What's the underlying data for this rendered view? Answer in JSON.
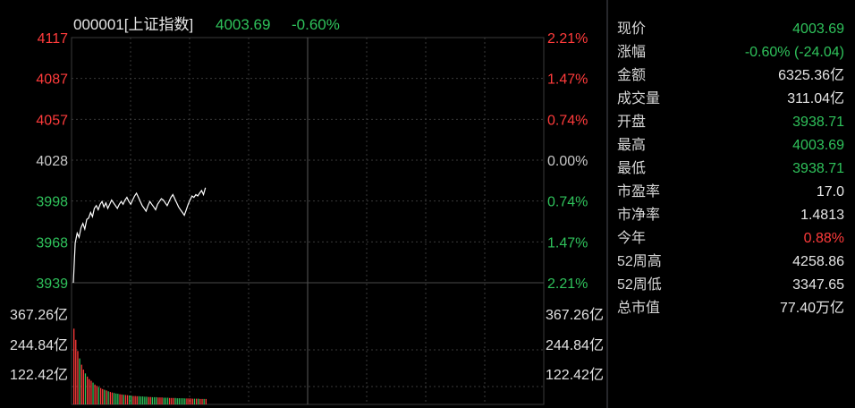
{
  "header": {
    "code_name": "000001[上证指数]",
    "price": "4003.69",
    "change_pct": "-0.60%"
  },
  "colors": {
    "up": "#ff3b3b",
    "down": "#2fc25b",
    "neutral": "#c8c8c8",
    "grid": "#3a3a3a",
    "price_line": "#ffffff"
  },
  "price_axis": {
    "left_ticks": [
      {
        "label": "4117",
        "tone": "up"
      },
      {
        "label": "4087",
        "tone": "up"
      },
      {
        "label": "4057",
        "tone": "up"
      },
      {
        "label": "4028",
        "tone": "neutral"
      },
      {
        "label": "3998",
        "tone": "down"
      },
      {
        "label": "3968",
        "tone": "down"
      },
      {
        "label": "3939",
        "tone": "down"
      }
    ],
    "right_ticks": [
      {
        "label": "2.21%",
        "tone": "up"
      },
      {
        "label": "1.47%",
        "tone": "up"
      },
      {
        "label": "0.74%",
        "tone": "up"
      },
      {
        "label": "0.00%",
        "tone": "neutral"
      },
      {
        "label": "0.74%",
        "tone": "down"
      },
      {
        "label": "1.47%",
        "tone": "down"
      },
      {
        "label": "2.21%",
        "tone": "down"
      }
    ]
  },
  "volume_axis": {
    "left_ticks": [
      "367.26亿",
      "244.84亿",
      "122.42亿"
    ],
    "right_ticks": [
      "367.26亿",
      "244.84亿",
      "122.42亿"
    ]
  },
  "chart_data": {
    "type": "line",
    "ylim": [
      3939,
      4117
    ],
    "total_minutes": 240,
    "prices": [
      3939,
      3968,
      3975,
      3972,
      3979,
      3982,
      3978,
      3985,
      3986,
      3990,
      3987,
      3993,
      3995,
      3992,
      3996,
      3998,
      3994,
      3997,
      3993,
      3996,
      3999,
      3997,
      3995,
      3993,
      3996,
      3998,
      3996,
      3999,
      4001,
      3998,
      3996,
      3999,
      4002,
      4004,
      4001,
      3998,
      3995,
      3993,
      3991,
      3995,
      3998,
      3996,
      3994,
      3992,
      3996,
      3998,
      4000,
      3999,
      3997,
      3995,
      3998,
      4001,
      4003,
      4000,
      3997,
      3994,
      3992,
      3990,
      3988,
      3992,
      3996,
      3999,
      4002,
      4001,
      4003,
      4002,
      4004,
      4006,
      4003,
      4008
    ],
    "volume_ylim": [
      0,
      367.26
    ],
    "volumes": [
      305,
      260,
      215,
      185,
      160,
      140,
      125,
      112,
      102,
      95,
      88,
      80,
      75,
      70,
      66,
      62,
      59,
      56,
      53,
      50,
      48,
      46,
      44,
      43,
      41,
      40,
      39,
      38,
      37,
      36,
      35,
      34,
      34,
      33,
      33,
      32,
      32,
      31,
      31,
      30,
      30,
      29,
      29,
      29,
      28,
      28,
      28,
      27,
      27,
      27,
      26,
      26,
      26,
      26,
      25,
      25,
      25,
      25,
      24,
      24,
      24,
      24,
      23,
      23,
      23,
      23,
      22,
      22,
      22,
      22
    ],
    "volume_dirs": [
      "up",
      "up",
      "up",
      "down",
      "up",
      "up",
      "down",
      "up",
      "up",
      "up",
      "down",
      "up",
      "up",
      "down",
      "up",
      "up",
      "down",
      "up",
      "down",
      "up",
      "up",
      "down",
      "down",
      "down",
      "up",
      "up",
      "down",
      "up",
      "up",
      "down",
      "down",
      "up",
      "up",
      "up",
      "down",
      "down",
      "down",
      "down",
      "down",
      "up",
      "up",
      "down",
      "down",
      "down",
      "up",
      "up",
      "up",
      "down",
      "down",
      "down",
      "up",
      "up",
      "up",
      "down",
      "down",
      "down",
      "down",
      "down",
      "down",
      "up",
      "up",
      "up",
      "up",
      "down",
      "up",
      "down",
      "up",
      "up",
      "down",
      "up"
    ]
  },
  "stats": [
    {
      "label": "现价",
      "value": "4003.69",
      "tone": "green"
    },
    {
      "label": "涨幅",
      "value": "-0.60% (-24.04)",
      "tone": "green"
    },
    {
      "label": "金额",
      "value": "6325.36亿",
      "tone": "white"
    },
    {
      "label": "成交量",
      "value": "311.04亿",
      "tone": "white"
    },
    {
      "label": "开盘",
      "value": "3938.71",
      "tone": "green"
    },
    {
      "label": "最高",
      "value": "4003.69",
      "tone": "green"
    },
    {
      "label": "最低",
      "value": "3938.71",
      "tone": "green"
    },
    {
      "label": "市盈率",
      "value": "17.0",
      "tone": "white"
    },
    {
      "label": "市净率",
      "value": "1.4813",
      "tone": "white"
    },
    {
      "label": "今年",
      "value": "0.88%",
      "tone": "red"
    },
    {
      "label": "52周高",
      "value": "4258.86",
      "tone": "white"
    },
    {
      "label": "52周低",
      "value": "3347.65",
      "tone": "white"
    },
    {
      "label": "总市值",
      "value": "77.40万亿",
      "tone": "white"
    }
  ]
}
